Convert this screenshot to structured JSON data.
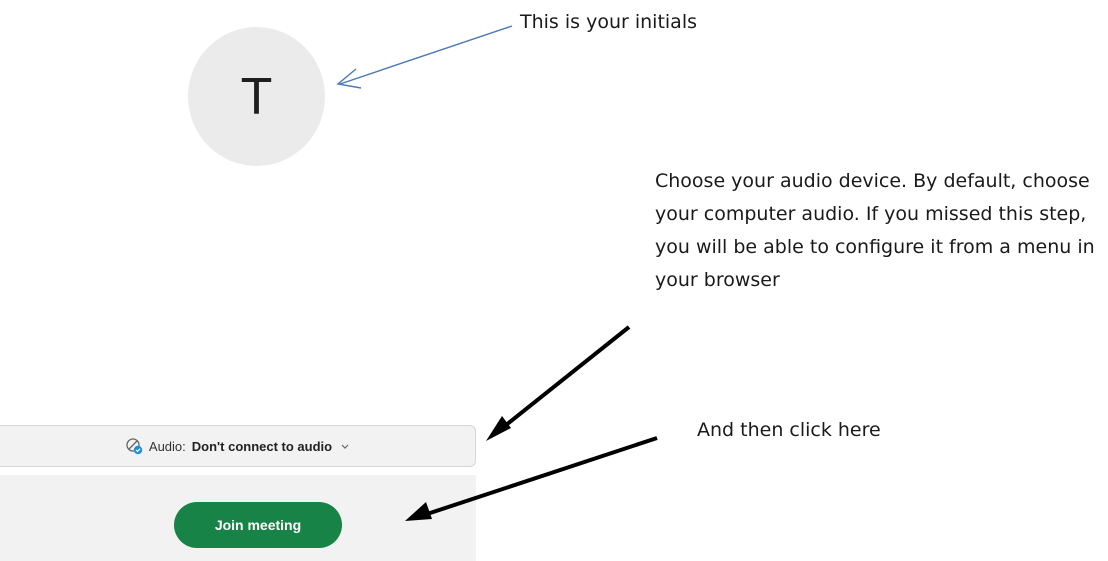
{
  "avatar": {
    "initial": "T"
  },
  "annotations": {
    "initials_note": "This is your initials",
    "audio_note": "Choose your audio device. By default, choose your computer audio. If you missed this step, you will be able to configure it from a menu in your browser",
    "click_note": "And then click here"
  },
  "audio_selector": {
    "label": "Audio:",
    "value": "Don't connect to audio",
    "icon": "audio-disconnected-icon"
  },
  "join_button": {
    "label": "Join meeting",
    "color": "#188346"
  },
  "colors": {
    "avatar_bg": "#ebebeb",
    "panel_bg": "#f2f2f2",
    "arrow_blue": "#4a78b8",
    "arrow_black": "#000000"
  }
}
